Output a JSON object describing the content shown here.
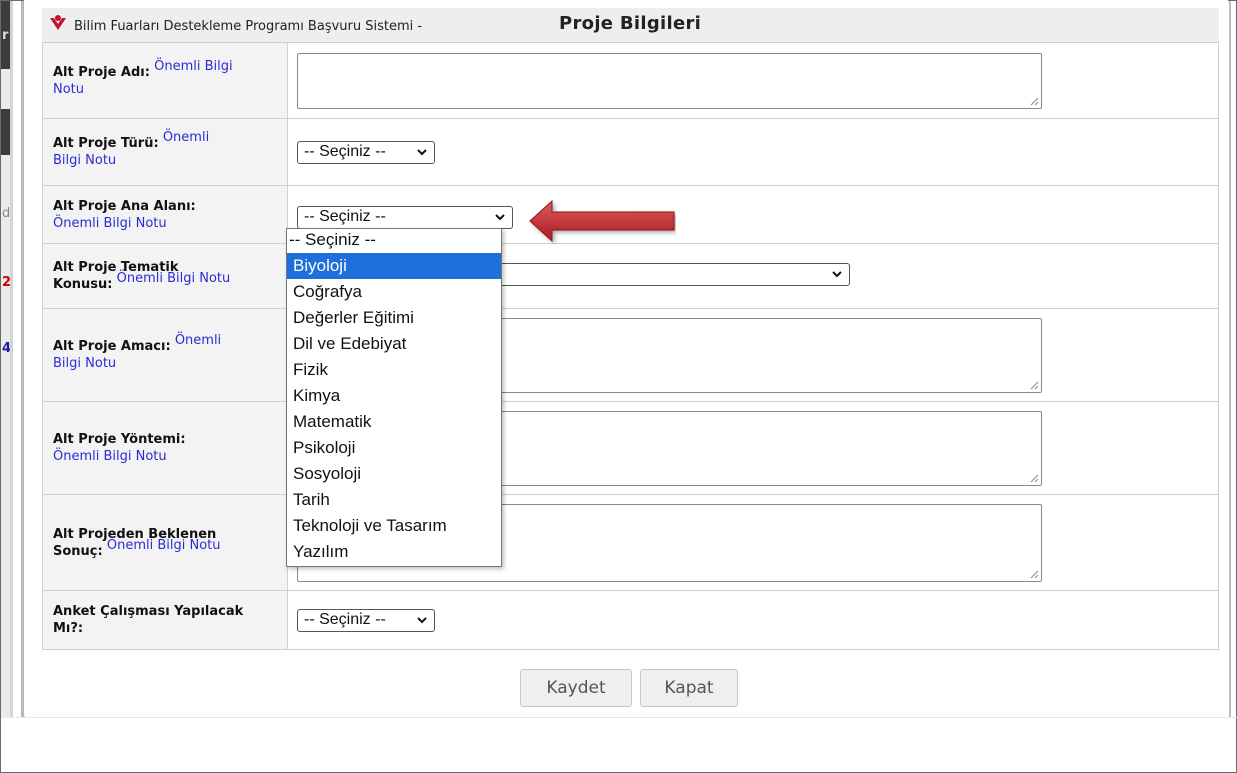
{
  "window": {
    "app_title": "Bilim Fuarları Destekleme Programı Başvuru Sistemi -",
    "page_title": "Proje Bilgileri"
  },
  "background_fragments": {
    "a": "r",
    "b": "2",
    "c": "4",
    "d": "d"
  },
  "form": {
    "note_text": "Önemli Bilgi Notu",
    "rows": [
      {
        "label": "Alt Proje Adı:",
        "note_line1": "Önemli Bilgi",
        "note_line2": "Notu",
        "control": "textarea",
        "value": ""
      },
      {
        "label": "Alt Proje Türü:",
        "note_line1": "Önemli",
        "note_line2": "Bilgi Notu",
        "control": "select",
        "value": "-- Seçiniz --"
      },
      {
        "label": "Alt Proje Ana Alanı:",
        "note_line1": "",
        "note_line2": "Önemli Bilgi Notu",
        "control": "select",
        "value": "-- Seçiniz --",
        "open": true
      },
      {
        "label_line1": "Alt Proje Tematik",
        "label_line2": "Konusu:",
        "note_line1": "Önemli Bilgi Notu",
        "control": "select",
        "value": ""
      },
      {
        "label": "Alt Proje Amacı:",
        "note_line1": "Önemli",
        "note_line2": "Bilgi Notu",
        "control": "textarea",
        "value": ""
      },
      {
        "label": "Alt Proje Yöntemi:",
        "note_line2": "Önemli Bilgi Notu",
        "control": "textarea",
        "value": ""
      },
      {
        "label_line1": "Alt Projeden Beklenen",
        "label_line2": "Sonuç:",
        "note_line1": "Önemli Bilgi Notu",
        "control": "textarea",
        "value": ""
      },
      {
        "label_line1": "Anket Çalışması Yapılacak",
        "label_line2": "Mı?:",
        "control": "select",
        "value": "-- Seçiniz --"
      }
    ]
  },
  "dropdown": {
    "selected": "Biyoloji",
    "options": [
      "-- Seçiniz --",
      "Biyoloji",
      "Coğrafya",
      "Değerler Eğitimi",
      "Dil ve Edebiyat",
      "Fizik",
      "Kimya",
      "Matematik",
      "Psikoloji",
      "Sosyoloji",
      "Tarih",
      "Teknoloji ve Tasarım",
      "Yazılım"
    ]
  },
  "buttons": {
    "save": "Kaydet",
    "close": "Kapat"
  },
  "colors": {
    "link": "#2b2bd6",
    "highlight": "#1e6fd9",
    "arrow": "#c0282a",
    "logo": "#c3122e"
  }
}
